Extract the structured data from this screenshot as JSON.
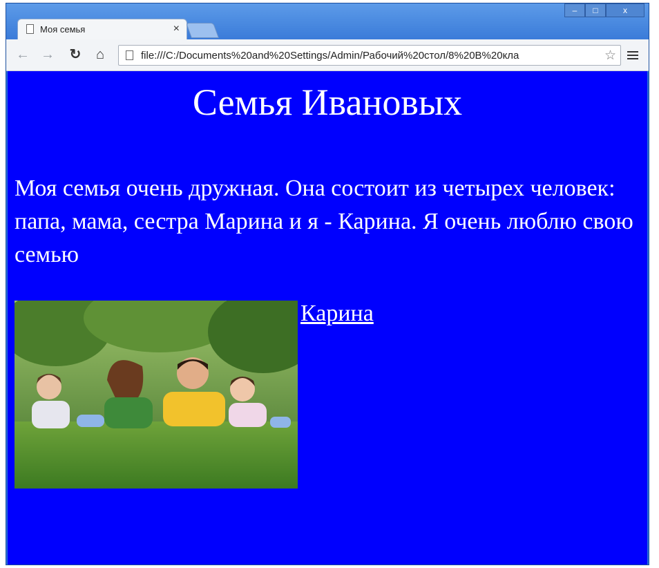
{
  "window": {
    "tab_title": "Моя семья",
    "tab_close": "×",
    "controls": {
      "minimize": "–",
      "maximize": "□",
      "close": "x"
    }
  },
  "toolbar": {
    "back": "←",
    "forward": "→",
    "reload": "↻",
    "home": "⌂",
    "url": "file:///C:/Documents%20and%20Settings/Admin/Рабочий%20стол/8%20В%20кла",
    "star": "☆"
  },
  "page": {
    "heading": "Семья Ивановых",
    "paragraph": "Моя семья очень дружная. Она состоит из четырех человек: папа, мама, сестра Марина и я - Карина. Я очень люблю свою семью",
    "link_text": "Карина"
  }
}
